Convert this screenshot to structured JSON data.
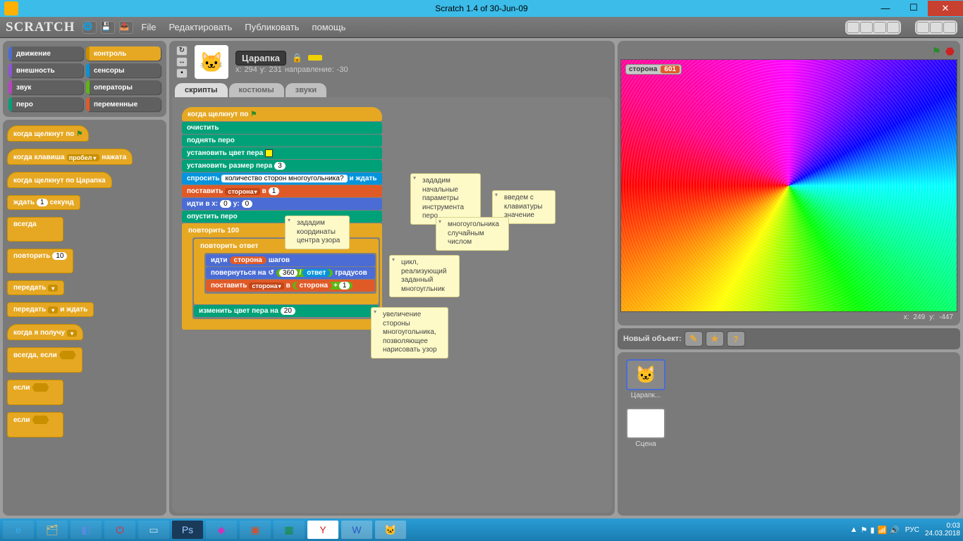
{
  "window": {
    "title": "Scratch 1.4 of 30-Jun-09"
  },
  "menubar": {
    "logo": "SCRATCH",
    "items": {
      "file": "File",
      "edit": "Редактировать",
      "share": "Публиковать",
      "help": "помощь"
    }
  },
  "categories": {
    "motion": "движение",
    "control": "контроль",
    "looks": "внешность",
    "sensing": "сенсоры",
    "sound": "звук",
    "operators": "операторы",
    "pen": "перо",
    "variables": "переменные"
  },
  "palette": {
    "hat_flag": "когда щелкнут по",
    "hat_key_pre": "когда клавиша",
    "hat_key_dd": "пробел",
    "hat_key_post": "нажата",
    "hat_sprite": "когда щелкнут по  Царапка",
    "wait_pre": "ждать",
    "wait_val": "1",
    "wait_post": "секунд",
    "forever": "всегда",
    "repeat": "повторить",
    "repeat_val": "10",
    "broadcast": "передать",
    "broadcast_wait_pre": "передать",
    "broadcast_wait_post": "и ждать",
    "receive": "когда я получу",
    "forever_if": "всегда, если",
    "if": "если",
    "if2": "если"
  },
  "sprite": {
    "name": "Царапка",
    "x_lbl": "x:",
    "x": "294",
    "y_lbl": "y:",
    "y": "231",
    "dir_lbl": "направление:",
    "dir": "-30"
  },
  "tabs": {
    "scripts": "скрипты",
    "costumes": "костюмы",
    "sounds": "звуки"
  },
  "script": {
    "hat": "когда щелкнут по",
    "clear": "очистить",
    "penup": "поднять перо",
    "setcolor": "установить цвет пера",
    "setsize_pre": "установить размер пера",
    "setsize_val": "3",
    "ask_pre": "спросить",
    "ask_q": "количество сторон многоугольника?",
    "ask_post": "и ждать",
    "setvar_pre": "поставить",
    "setvar_dd": "сторона",
    "setvar_mid": "в",
    "setvar_val": "1",
    "goto_pre": "идти в x:",
    "goto_x": "0",
    "goto_mid": "y:",
    "goto_y": "0",
    "pendown": "опустить перо",
    "repeat_pre": "повторить",
    "repeat_val": "100",
    "repeat2_pre": "повторить",
    "repeat2_rep": "ответ",
    "move_pre": "идти",
    "move_rep": "сторона",
    "move_post": "шагов",
    "turn_pre": "повернуться на",
    "turn_num": "360",
    "turn_div": "/",
    "turn_den": "ответ",
    "turn_post": "градусов",
    "setvar2_pre": "поставить",
    "setvar2_dd": "сторона",
    "setvar2_mid": "в",
    "setvar2_rep": "сторона",
    "setvar2_plus": "+",
    "setvar2_one": "1",
    "changec_pre": "изменить цвет пера на",
    "changec_val": "20"
  },
  "comments": {
    "c1": "зададим начальные параметры инструмента перо",
    "c2": "введем с клавиатуры значение",
    "c3": "многоугольника случайным числом",
    "c4": "зададим координаты центра узора",
    "c5": "цикл, реализующий заданный многоугльник",
    "c6": "увеличение стороны многоугольника, позволяющее нарисовать узор"
  },
  "stage": {
    "var_name": "сторона",
    "var_val": "601",
    "mx_lbl": "x:",
    "mx": "249",
    "my_lbl": "y:",
    "my": "-447"
  },
  "new_obj": {
    "label": "Новый объект:"
  },
  "sprite_list": {
    "sprite1": "Царапк...",
    "stage": "Сцена"
  },
  "taskbar": {
    "lang": "РУС",
    "time": "0:03",
    "date": "24.03.2018",
    "tray_up": "▲"
  }
}
